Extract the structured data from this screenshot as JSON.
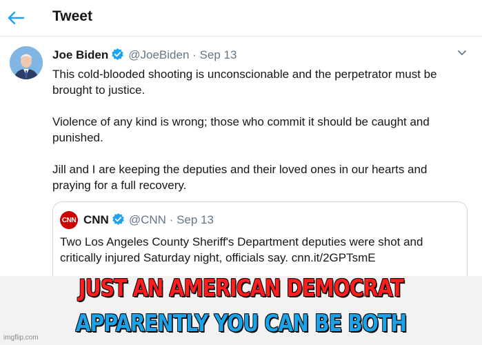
{
  "header": {
    "title": "Tweet",
    "back_icon": "arrow-left-icon"
  },
  "tweet": {
    "author_name": "Joe Biden",
    "verified_icon": "verified-badge-icon",
    "handle": "@JoeBiden",
    "separator": "·",
    "date": "Sep 13",
    "menu_icon": "chevron-down-icon",
    "paragraphs": [
      "This cold-blooded shooting is unconscionable and the perpetrator must be brought to justice.",
      "Violence of any kind is wrong; those who commit it should be caught and punished.",
      "Jill and I are keeping the deputies and their loved ones in our hearts and praying for a full recovery."
    ]
  },
  "quoted_tweet": {
    "logo_text": "CNN",
    "author_name": "CNN",
    "handle": "@CNN",
    "separator": "·",
    "date": "Sep 13",
    "text": "Two Los Angeles County Sheriff's Department deputies were shot and critically injured Saturday night, officials say. cnn.it/2GPTsmE"
  },
  "meme": {
    "line1": "JUST AN AMERICAN DEMOCRAT",
    "line2": "APPARENTLY YOU CAN BE BOTH",
    "line1_color": "#ff1d1d",
    "line2_color": "#1aa3e8",
    "watermark": "imgflip.com"
  },
  "colors": {
    "accent": "#1da1f2",
    "secondary_text": "#657786",
    "border": "#ccd6dd"
  }
}
